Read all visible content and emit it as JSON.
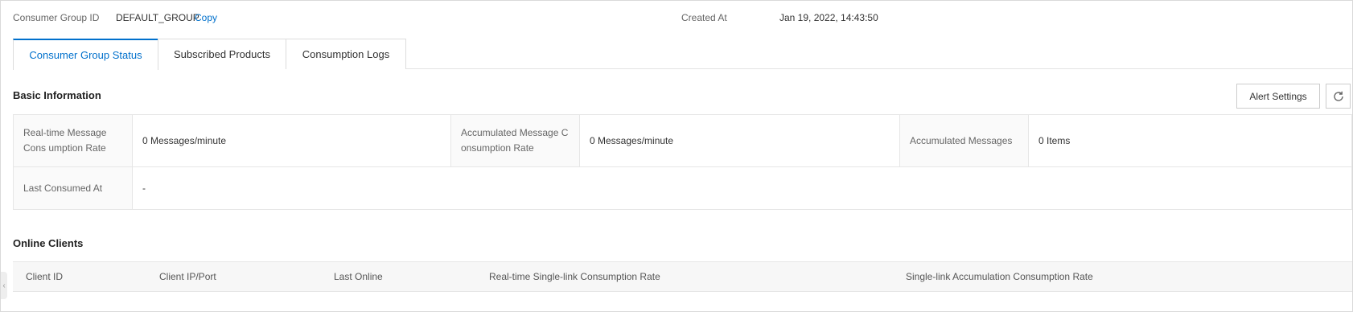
{
  "header": {
    "consumer_group_label": "Consumer Group ID",
    "consumer_group_value": "DEFAULT_GROUP",
    "copy_label": "Copy",
    "created_at_label": "Created At",
    "created_at_value": "Jan 19, 2022, 14:43:50"
  },
  "tabs": [
    {
      "label": "Consumer Group Status",
      "active": true
    },
    {
      "label": "Subscribed Products",
      "active": false
    },
    {
      "label": "Consumption Logs",
      "active": false
    }
  ],
  "basic_info": {
    "title": "Basic Information",
    "alert_settings_label": "Alert Settings",
    "refresh_icon": "refresh-icon",
    "fields": {
      "realtime_rate_label": "Real-time Message Cons umption Rate",
      "realtime_rate_value": "0 Messages/minute",
      "accumulated_rate_label": "Accumulated Message C onsumption Rate",
      "accumulated_rate_value": "0 Messages/minute",
      "accumulated_messages_label": "Accumulated Messages",
      "accumulated_messages_value": "0 Items",
      "last_consumed_label": "Last Consumed At",
      "last_consumed_value": "-"
    }
  },
  "online_clients": {
    "title": "Online Clients",
    "columns": [
      "Client ID",
      "Client IP/Port",
      "Last Online",
      "Real-time Single-link Consumption Rate",
      "Single-link Accumulation Consumption Rate"
    ]
  },
  "colors": {
    "accent": "#0070cc",
    "border": "#e6e6e6",
    "label_bg": "#fafafa"
  }
}
